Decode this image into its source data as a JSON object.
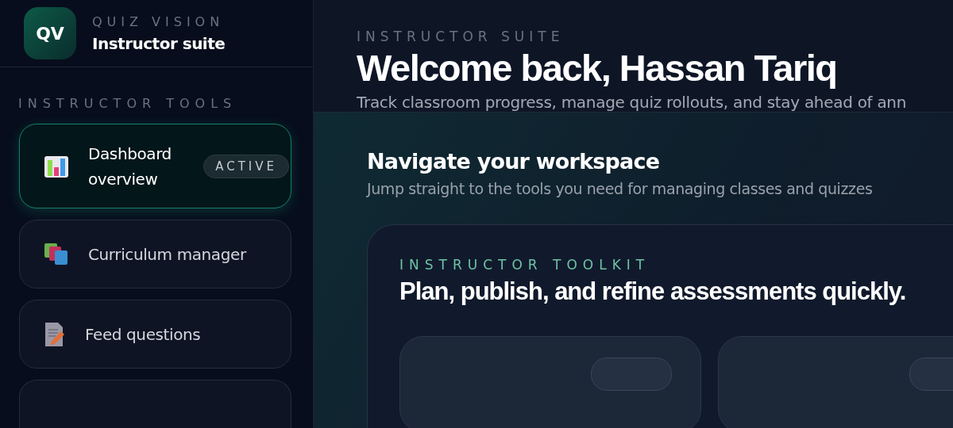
{
  "brand": {
    "logo": "QV",
    "name": "QUIZ VISION",
    "subtitle": "Instructor suite"
  },
  "sidebar": {
    "heading": "INSTRUCTOR TOOLS",
    "items": [
      {
        "label": "Dashboard overview",
        "kind": "chart",
        "selected": true,
        "badge": "ACTIVE"
      },
      {
        "label": "Curriculum manager",
        "kind": "books",
        "selected": false
      },
      {
        "label": "Feed questions",
        "kind": "document",
        "selected": false
      }
    ]
  },
  "header": {
    "eyebrow": "INSTRUCTOR SUITE",
    "title": "Welcome back, Hassan Tariq",
    "subtitle": "Track classroom progress, manage quiz rollouts, and stay ahead of ann"
  },
  "section": {
    "title": "Navigate your workspace",
    "subtitle": "Jump straight to the tools you need for managing classes and quizzes"
  },
  "toolkit": {
    "eyebrow": "INSTRUCTOR TOOLKIT",
    "title": "Plan, publish, and refine assessments quickly."
  }
}
